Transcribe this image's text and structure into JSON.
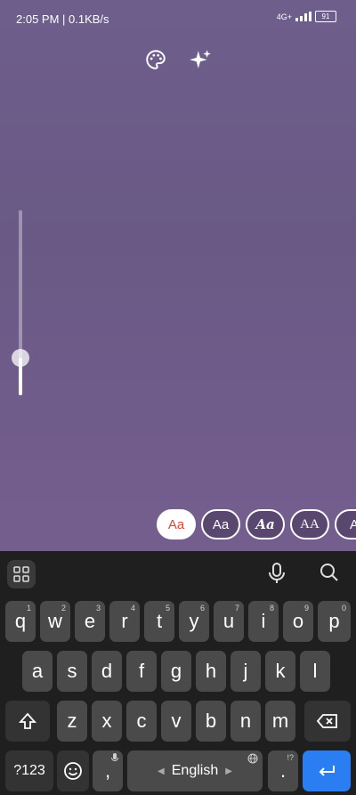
{
  "status": {
    "time": "2:05 PM | 0.1KB/s",
    "net": "4G+",
    "battery": "91"
  },
  "fonts": [
    {
      "label": "Aa"
    },
    {
      "label": "Aa"
    },
    {
      "label": "Aa"
    },
    {
      "label": "AA"
    },
    {
      "label": "A"
    }
  ],
  "slider": {
    "level": 0.2
  },
  "keyboard": {
    "row1": [
      "q",
      "w",
      "e",
      "r",
      "t",
      "y",
      "u",
      "i",
      "o",
      "p"
    ],
    "row1_nums": [
      "1",
      "2",
      "3",
      "4",
      "5",
      "6",
      "7",
      "8",
      "9",
      "0"
    ],
    "row2": [
      "a",
      "s",
      "d",
      "f",
      "g",
      "h",
      "j",
      "k",
      "l"
    ],
    "row3": [
      "z",
      "x",
      "c",
      "v",
      "b",
      "n",
      "m"
    ],
    "sym_label": "?123",
    "comma": ",",
    "space_label": "English",
    "period": ".",
    "period_sup": "!?"
  }
}
